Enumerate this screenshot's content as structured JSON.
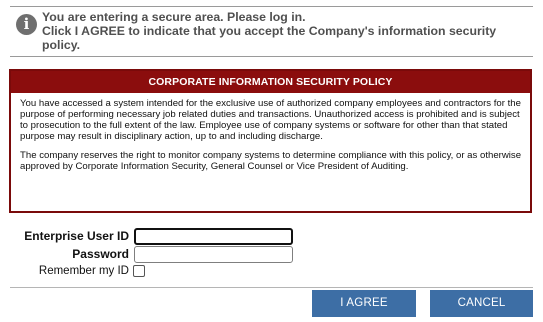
{
  "notice": {
    "icon": "info-icon",
    "lines": [
      "You are entering a secure area.  Please log in.",
      "Click I AGREE to indicate that you accept the Company's information security",
      "policy."
    ]
  },
  "policy": {
    "title": "CORPORATE INFORMATION SECURITY POLICY",
    "paragraph1": "You have accessed a system intended for the exclusive use of authorized company employees and contractors for the purpose of performing necessary job related duties and transactions. Unauthorized access is prohibited and is subject to prosecution to the full extent of the law. Employee use of company systems or software for other than that stated purpose may result in disciplinary action, up to and including discharge.",
    "paragraph2": "The company reserves the right to monitor company systems to determine compliance with this policy, or as otherwise approved by Corporate Information Security, General Counsel or Vice President of Auditing.",
    "header_color": "#8b0d0d"
  },
  "form": {
    "user_label": "Enterprise User ID",
    "user_value": "",
    "password_label": "Password",
    "password_value": "",
    "remember_label": "Remember my ID",
    "remember_checked": false
  },
  "buttons": {
    "agree": "I AGREE",
    "cancel": "CANCEL",
    "color": "#3d6ea5"
  }
}
